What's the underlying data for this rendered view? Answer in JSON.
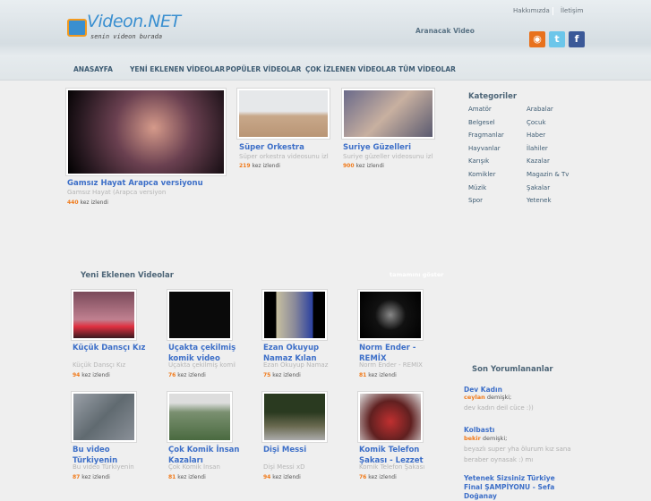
{
  "header": {
    "logo_text": "Videon.NET",
    "logo_tagline": "senin videon burada",
    "links": [
      "Hakkımızda",
      "İletişim"
    ],
    "search_label": "Aranacak Video",
    "social": [
      {
        "name": "rss",
        "color": "#e8711c"
      },
      {
        "name": "twitter",
        "color": "#5fc0e8"
      },
      {
        "name": "facebook",
        "color": "#3b5998"
      }
    ]
  },
  "nav": [
    "ANASAYFA",
    "YENİ EKLENEN VİDEOLAR",
    "POPÜLER VİDEOLAR",
    "ÇOK İZLENEN VİDEOLAR",
    "TÜM VİDEOLAR"
  ],
  "views_suffix": "kez izlendi",
  "featured": [
    {
      "title": "Gamsız Hayat Arapca versiyonu",
      "desc": "Gamsız Hayat (Arapca versiyon",
      "views": "440"
    },
    {
      "title": "Süper Orkestra",
      "desc": "Süper orkestra videosunu izle",
      "views": "219"
    },
    {
      "title": "Suriye Güzelleri",
      "desc": "Suriye güzeller videosunu izl",
      "views": "900"
    }
  ],
  "categories": {
    "title": "Kategoriler",
    "items": [
      "Amatör",
      "Arabalar",
      "Belgesel",
      "Çocuk",
      "Fragmanlar",
      "Haber",
      "Hayvanlar",
      "İlahiler",
      "Karışık",
      "Kazalar",
      "Komikler",
      "Magazin & Tv",
      "Müzik",
      "Şakalar",
      "Spor",
      "Yetenek"
    ]
  },
  "new_videos": {
    "title": "Yeni Eklenen Videolar",
    "show_all": "tamamını göster",
    "items": [
      {
        "title": "Küçük Dansçı Kız",
        "desc": "Küçük Dansçı Kız",
        "views": "94"
      },
      {
        "title": "Uçakta çekilmiş komik video",
        "desc": "Uçakta çekilmiş komik",
        "views": "76"
      },
      {
        "title": "Ezan Okuyup Namaz Kılan",
        "desc": "Ezan Okuyup Namaz",
        "views": "75"
      },
      {
        "title": "Norm Ender - REMİX",
        "desc": "Norm Ender - REMİX",
        "views": "81"
      },
      {
        "title": "Bu video Türkiyenin",
        "desc": "Bu video Türkiyenin",
        "views": "87"
      },
      {
        "title": "Çok Komik İnsan Kazaları",
        "desc": "Çok Komik İnsan",
        "views": "81"
      },
      {
        "title": "Dişi Messi",
        "desc": "Dişi Messi xD",
        "views": "94"
      },
      {
        "title": "Komik Telefon Şakası - Lezzet",
        "desc": "Komik Telefon Şakası -",
        "views": "76"
      }
    ]
  },
  "comments": {
    "title": "Son Yorumlananlar",
    "said": "demişki;",
    "items": [
      {
        "title": "Dev Kadın",
        "user": "ceylan",
        "text": "dev kadın deil cüce :))"
      },
      {
        "title": "Kolbastı",
        "user": "bekir",
        "text": "beyazlı super yha ölurum kız sana beraber oynasak :) mı"
      },
      {
        "title": "Yetenek Sizsiniz Türkiye Final ŞAMPİYONU - Sefa Doğanay",
        "user": "",
        "text": ""
      }
    ]
  }
}
